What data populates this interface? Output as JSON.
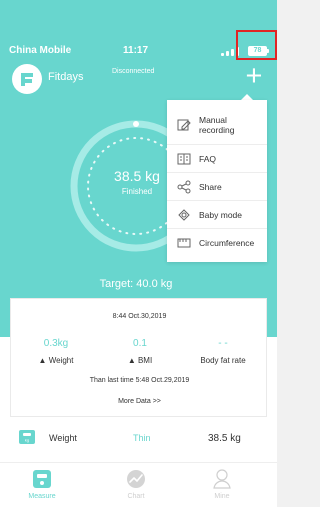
{
  "status_bar": {
    "carrier": "China Mobile",
    "time": "11:17",
    "battery": "78"
  },
  "header": {
    "app_name": "Fitdays",
    "connection_status": "Disconnected",
    "add_icon": "plus-icon"
  },
  "dial": {
    "weight": "38.5 kg",
    "status": "Finished",
    "target": "Target: 40.0 kg"
  },
  "menu": {
    "items": [
      {
        "label": "Manual recording",
        "icon": "edit-icon"
      },
      {
        "label": "FAQ",
        "icon": "book-icon"
      },
      {
        "label": "Share",
        "icon": "share-icon"
      },
      {
        "label": "Baby mode",
        "icon": "baby-icon"
      },
      {
        "label": "Circumference",
        "icon": "tape-icon"
      }
    ]
  },
  "result_card": {
    "timestamp": "8:44 Oct.30,2019",
    "metrics": [
      {
        "value": "0.3kg",
        "label": "Weight"
      },
      {
        "value": "0.1",
        "label": "BMI"
      },
      {
        "value": "- -",
        "label": "Body fat rate"
      }
    ],
    "comparison": "Than last time 5:48 Oct.29,2019",
    "more_link": "More Data >>"
  },
  "summary": {
    "label": "Weight",
    "status": "Thin",
    "value": "38.5 kg",
    "icon": "scale-icon"
  },
  "bottom_nav": {
    "items": [
      {
        "label": "Measure",
        "icon": "scale-icon"
      },
      {
        "label": "Chart",
        "icon": "chart-icon"
      },
      {
        "label": "Mine",
        "icon": "person-icon"
      }
    ]
  },
  "colors": {
    "accent": "#68d6ce",
    "text": "#333333",
    "muted": "#cfcfcf",
    "highlight": "#e12424"
  }
}
